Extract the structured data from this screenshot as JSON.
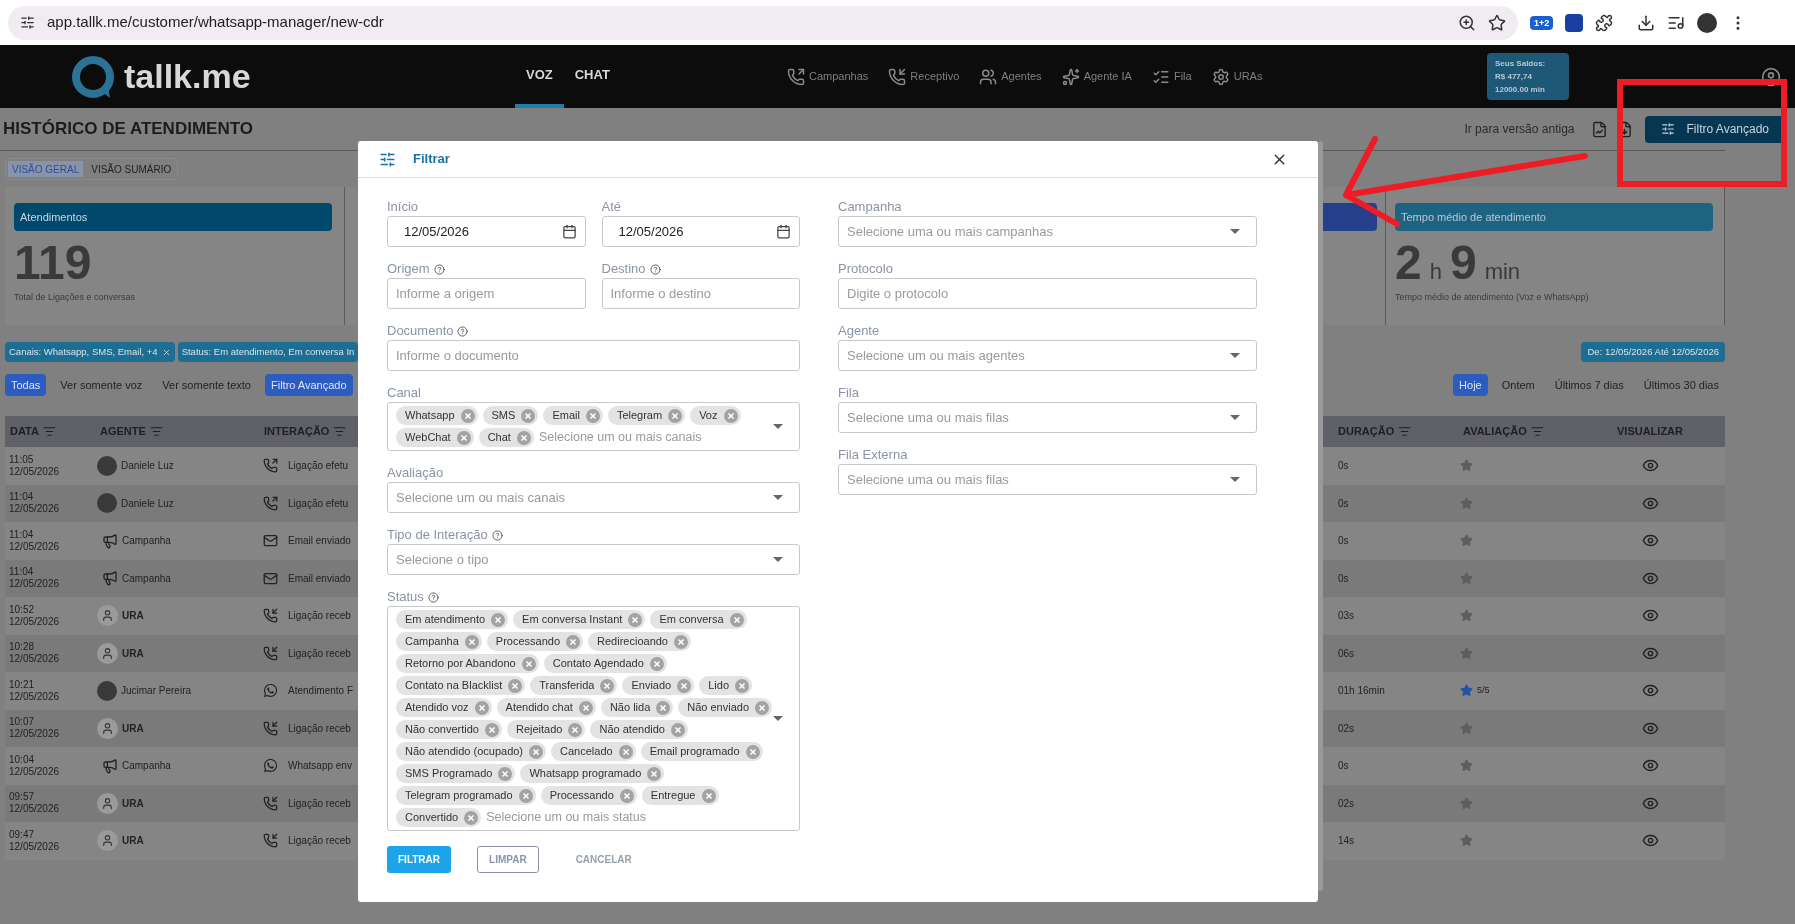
{
  "browser": {
    "url": "app.tallk.me/customer/whatsapp-manager/new-cdr",
    "extension_badge": "1+2"
  },
  "header": {
    "logo": "tallk.me",
    "tabs": [
      {
        "label": "VOZ",
        "selected": true
      },
      {
        "label": "CHAT",
        "selected": false
      }
    ],
    "nav": [
      {
        "label": "Campanhas",
        "kind": "call_out"
      },
      {
        "label": "Receptivo",
        "kind": "call_in"
      },
      {
        "label": "Agentes",
        "kind": "users"
      },
      {
        "label": "Agente IA",
        "kind": "sparkles"
      },
      {
        "label": "Fila",
        "kind": "list"
      },
      {
        "label": "URAs",
        "kind": "gear"
      }
    ],
    "balance": {
      "title": "Seus Saldos:",
      "amount": "R$ 477,74",
      "minutes": "12000.00 min"
    }
  },
  "page": {
    "title": "HISTÓRICO DE ATENDIMENTO",
    "old_version_link": "Ir para versão antiga",
    "advanced_filter_button": "Filtro Avançado",
    "view_tabs": [
      {
        "label": "VISÃO GERAL",
        "selected": true
      },
      {
        "label": "VISÃO SUMÁRIO",
        "selected": false
      }
    ],
    "card_left": {
      "title": "Atendimentos",
      "value": "119",
      "caption": "Total de Ligações e conversas"
    },
    "card_right": {
      "title": "Tempo médio de atendimento",
      "parts": [
        {
          "number": "2",
          "unit": "h"
        },
        {
          "number": "9",
          "unit": "min"
        }
      ],
      "caption": "Tempo médio de atendimento (Voz e WhatsApp)"
    },
    "filter_chips": [
      {
        "label": "Canais: Whatsapp, SMS, Email, +4",
        "removable": true
      },
      {
        "label": "Status: Em atendimento, Em conversa In",
        "removable": false
      }
    ],
    "date_chip": "De: 12/05/2026 Até 12/05/2026",
    "channel_filters": [
      {
        "label": "Todas",
        "selected": true
      },
      {
        "label": "Ver somente voz",
        "selected": false
      },
      {
        "label": "Ver somente texto",
        "selected": false
      },
      {
        "label": "Filtro Avançado",
        "selected": true
      }
    ],
    "period_filters": [
      {
        "label": "Hoje",
        "selected": true
      },
      {
        "label": "Ontem",
        "selected": false
      },
      {
        "label": "Últimos 7 dias",
        "selected": false
      },
      {
        "label": "Últimos 30 dias",
        "selected": false
      }
    ],
    "table": {
      "columns_left": [
        "DATA",
        "AGENTE",
        "INTERAÇÃO"
      ],
      "columns_right": [
        "DURAÇÃO",
        "AVALIAÇÃO",
        "VISUALIZAR"
      ],
      "rows": [
        {
          "time": "11:05",
          "date": "12/05/2026",
          "agent": {
            "name": "Daniele Luz",
            "kind": "photo"
          },
          "interaction": {
            "text": "Ligação efetu",
            "kind": "call_out"
          },
          "duration": "0s",
          "rated": false
        },
        {
          "time": "11:04",
          "date": "12/05/2026",
          "agent": {
            "name": "Daniele Luz",
            "kind": "photo"
          },
          "interaction": {
            "text": "Ligação efetu",
            "kind": "call_out"
          },
          "duration": "0s",
          "rated": false
        },
        {
          "time": "11:04",
          "date": "12/05/2026",
          "agent": {
            "name": "Campanha",
            "kind": "campaign"
          },
          "interaction": {
            "text": "Email enviado",
            "kind": "email"
          },
          "duration": "0s",
          "rated": false
        },
        {
          "time": "11:04",
          "date": "12/05/2026",
          "agent": {
            "name": "Campanha",
            "kind": "campaign"
          },
          "interaction": {
            "text": "Email enviado",
            "kind": "email"
          },
          "duration": "0s",
          "rated": false
        },
        {
          "time": "10:52",
          "date": "12/05/2026",
          "agent": {
            "name": "URA",
            "kind": "ura"
          },
          "interaction": {
            "text": "Ligação receb",
            "kind": "call_in"
          },
          "duration": "03s",
          "rated": false
        },
        {
          "time": "10:28",
          "date": "12/05/2026",
          "agent": {
            "name": "URA",
            "kind": "ura"
          },
          "interaction": {
            "text": "Ligação receb",
            "kind": "call_in"
          },
          "duration": "06s",
          "rated": false
        },
        {
          "time": "10:21",
          "date": "12/05/2026",
          "agent": {
            "name": "Jucimar Pereira",
            "kind": "photo"
          },
          "interaction": {
            "text": "Atendimento F",
            "kind": "whatsapp"
          },
          "duration": "01h 16min",
          "rated": true,
          "rating": "5/5"
        },
        {
          "time": "10:07",
          "date": "12/05/2026",
          "agent": {
            "name": "URA",
            "kind": "ura"
          },
          "interaction": {
            "text": "Ligação receb",
            "kind": "call_in"
          },
          "duration": "02s",
          "rated": false
        },
        {
          "time": "10:04",
          "date": "12/05/2026",
          "agent": {
            "name": "Campanha",
            "kind": "campaign"
          },
          "interaction": {
            "text": "Whatsapp env",
            "kind": "whatsapp"
          },
          "duration": "0s",
          "rated": false
        },
        {
          "time": "09:57",
          "date": "12/05/2026",
          "agent": {
            "name": "URA",
            "kind": "ura"
          },
          "interaction": {
            "text": "Ligação receb",
            "kind": "call_in"
          },
          "duration": "02s",
          "rated": false
        },
        {
          "time": "09:47",
          "date": "12/05/2026",
          "agent": {
            "name": "URA",
            "kind": "ura"
          },
          "interaction": {
            "text": "Ligação receb",
            "kind": "call_in"
          },
          "duration": "14s",
          "rated": false
        }
      ]
    }
  },
  "modal": {
    "title": "Filtrar",
    "left_rows": [
      [
        {
          "kind": "date",
          "label": "Início",
          "value": "12/05/2026",
          "help": false
        },
        {
          "kind": "date",
          "label": "Até",
          "value": "12/05/2026",
          "help": false
        }
      ],
      [
        {
          "kind": "text",
          "label": "Origem",
          "placeholder": "Informe a origem",
          "help": true
        },
        {
          "kind": "text",
          "label": "Destino",
          "placeholder": "Informe o destino",
          "help": true
        }
      ],
      [
        {
          "kind": "text",
          "label": "Documento",
          "placeholder": "Informe o documento",
          "help": true
        }
      ],
      [
        {
          "kind": "multiselect",
          "label": "Canal",
          "placeholder": "Selecione um ou mais canais",
          "help": false,
          "chips": [
            "Whatsapp",
            "SMS",
            "Email",
            "Telegram",
            "Voz",
            "WebChat",
            "Chat"
          ]
        }
      ],
      [
        {
          "kind": "select",
          "label": "Avaliação",
          "placeholder": "Selecione um ou mais canais",
          "help": false
        }
      ],
      [
        {
          "kind": "select",
          "label": "Tipo de Interação",
          "placeholder": "Selecione o tipo",
          "help": true
        }
      ],
      [
        {
          "kind": "multiselect",
          "label": "Status",
          "placeholder": "Selecione um ou mais status",
          "help": true,
          "chips": [
            "Em atendimento",
            "Em conversa Instant",
            "Em conversa",
            "Campanha",
            "Processando",
            "Redirecioando",
            "Retorno por Abandono",
            "Contato Agendado",
            "Contato na Blacklist",
            "Transferida",
            "Enviado",
            "Lido",
            "Atendido voz",
            "Atendido chat",
            "Não lida",
            "Não enviado",
            "Não convertido",
            "Rejeitado",
            "Não atendido",
            "Não atendido (ocupado)",
            "Cancelado",
            "Email programado",
            "SMS Programado",
            "Whatsapp programado",
            "Telegram programado",
            "Processando",
            "Entregue",
            "Convertido"
          ]
        }
      ]
    ],
    "right_fields": [
      {
        "kind": "select",
        "label": "Campanha",
        "placeholder": "Selecione uma ou mais campanhas",
        "help": false
      },
      {
        "kind": "text",
        "label": "Protocolo",
        "placeholder": "Digite o protocolo",
        "help": false
      },
      {
        "kind": "select",
        "label": "Agente",
        "placeholder": "Selecione um ou mais agentes",
        "help": false
      },
      {
        "kind": "select",
        "label": "Fila",
        "placeholder": "Selecione uma ou mais filas",
        "help": false
      },
      {
        "kind": "select",
        "label": "Fila Externa",
        "placeholder": "Selecione uma ou mais filas",
        "help": false
      }
    ],
    "buttons": [
      {
        "label": "FILTRAR",
        "kind": "primary"
      },
      {
        "label": "LIMPAR",
        "kind": "outlined"
      },
      {
        "label": "CANCELAR",
        "kind": "text"
      }
    ]
  }
}
